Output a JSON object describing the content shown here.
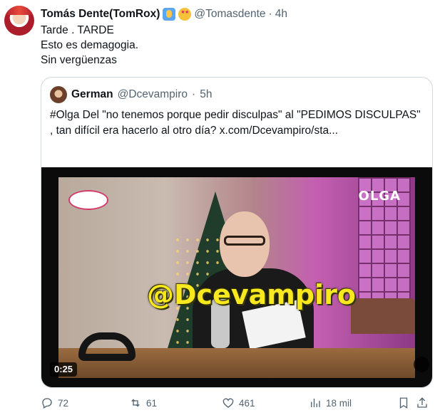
{
  "tweet": {
    "author_name": "Tomás Dente(TomRox)",
    "handle": "@Tomasdente",
    "separator": "·",
    "time": "4h",
    "lines": [
      "Tarde . TARDE",
      "Esto es demagogia.",
      "Sin vergüenzas"
    ]
  },
  "quote": {
    "author_name": "German",
    "handle": "@Dcevampiro",
    "separator": "·",
    "time": "5h",
    "text": "#Olga Del \"no tenemos porque pedir disculpas\" al \"PEDIMOS DISCULPAS\" , tan difícil era hacerlo al otro día? x.com/Dcevampiro/sta..."
  },
  "video": {
    "channel_label": "OLGA",
    "overlay_text": "@Dcevampiro",
    "duration": "0:25"
  },
  "actions": {
    "replies": "72",
    "reposts": "61",
    "likes": "461",
    "views": "18 mil"
  },
  "colors": {
    "text": "#0f1419",
    "muted": "#536471",
    "border": "#cfd9de",
    "overlay_yellow": "#f7e81f"
  },
  "icons": {
    "reply": "reply-icon",
    "repost": "repost-icon",
    "like": "heart-icon",
    "views": "views-icon",
    "bookmark": "bookmark-icon",
    "share": "share-icon",
    "badge1": "raising-hand-emoji",
    "badge2": "star-struck-emoji"
  }
}
